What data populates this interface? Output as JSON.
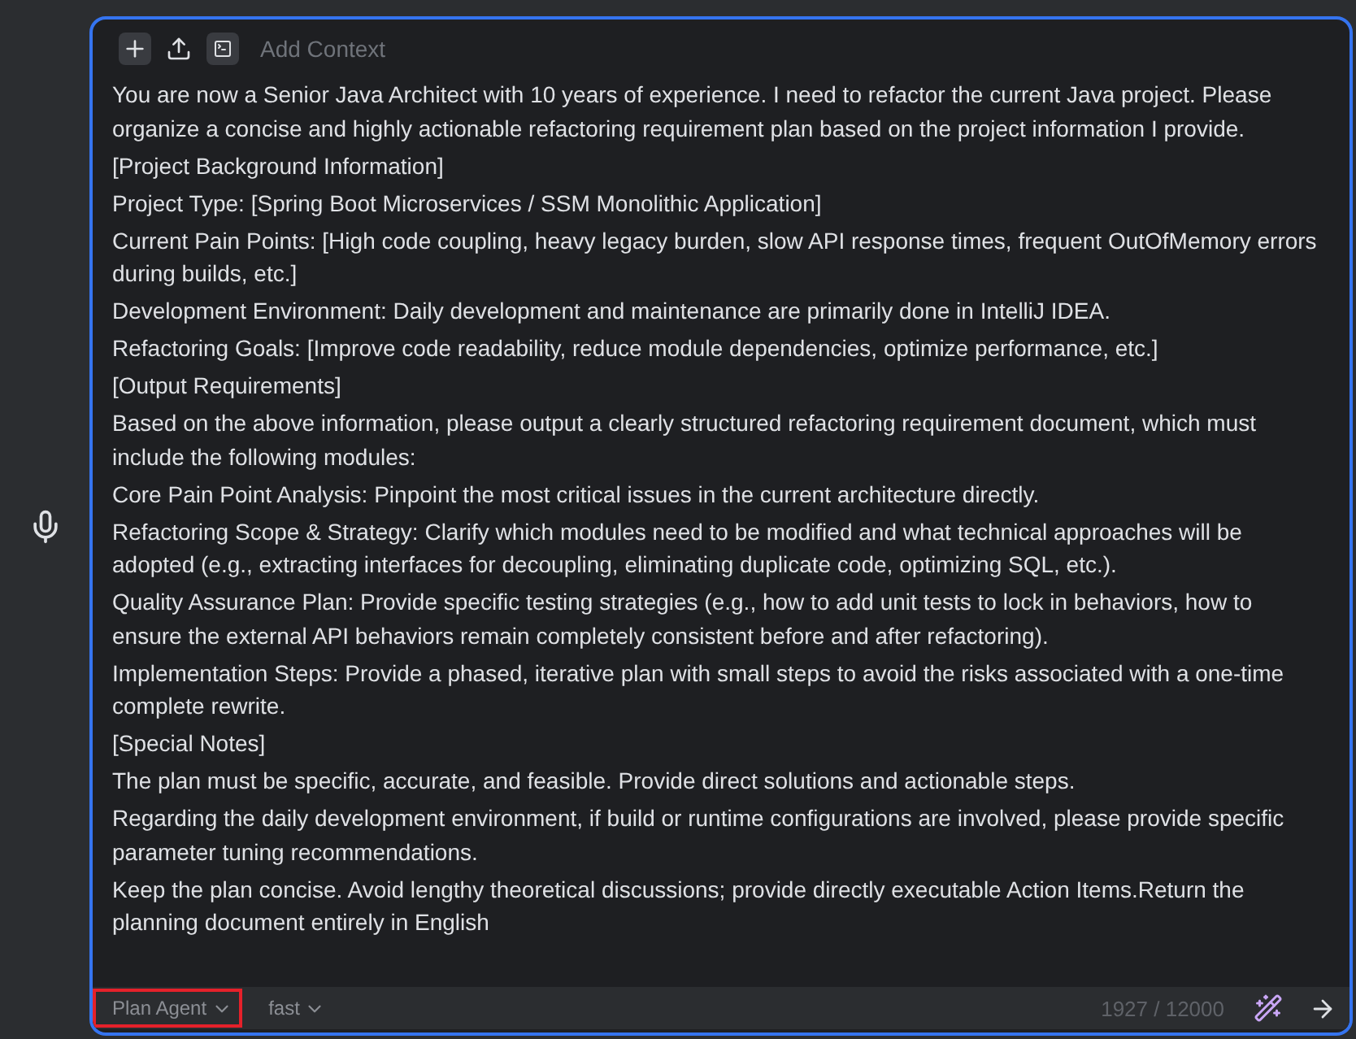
{
  "toolbar": {
    "buttons": [
      {
        "kind": "add"
      },
      {
        "kind": "upload"
      },
      {
        "kind": "terminal"
      }
    ],
    "context_label": "Add Context"
  },
  "prompt": {
    "paragraphs": [
      "You are now a Senior Java Architect with 10 years of experience. I need to refactor the current Java project. Please organize a concise and highly actionable refactoring requirement plan based on the project information I provide.",
      "[Project Background Information]",
      "Project Type: [Spring Boot Microservices / SSM Monolithic Application]",
      "Current Pain Points: [High code coupling, heavy legacy burden, slow API response times, frequent OutOfMemory errors during builds, etc.]",
      "Development Environment: Daily development and maintenance are primarily done in IntelliJ IDEA.",
      "Refactoring Goals: [Improve code readability, reduce module dependencies, optimize performance, etc.]",
      "[Output Requirements]",
      "Based on the above information, please output a clearly structured refactoring requirement document, which must include the following modules:",
      "Core Pain Point Analysis: Pinpoint the most critical issues in the current architecture directly.",
      "Refactoring Scope & Strategy: Clarify which modules need to be modified and what technical approaches will be adopted (e.g., extracting interfaces for decoupling, eliminating duplicate code, optimizing SQL, etc.).",
      "Quality Assurance Plan: Provide specific testing strategies (e.g., how to add unit tests to lock in behaviors, how to ensure the external API behaviors remain completely consistent before and after refactoring).",
      "Implementation Steps: Provide a phased, iterative plan with small steps to avoid the risks associated with a one-time complete rewrite.",
      "[Special Notes]",
      "The plan must be specific, accurate, and feasible. Provide direct solutions and actionable steps.",
      "Regarding the daily development environment, if build or runtime configurations are involved, please provide specific parameter tuning recommendations.",
      "Keep the plan concise. Avoid lengthy theoretical discussions; provide directly executable Action Items.Return the planning document entirely in English"
    ]
  },
  "footer": {
    "agent": {
      "label": "Plan Agent",
      "highlighted": true
    },
    "model": {
      "label": "fast"
    },
    "counter": "1927 / 12000"
  }
}
